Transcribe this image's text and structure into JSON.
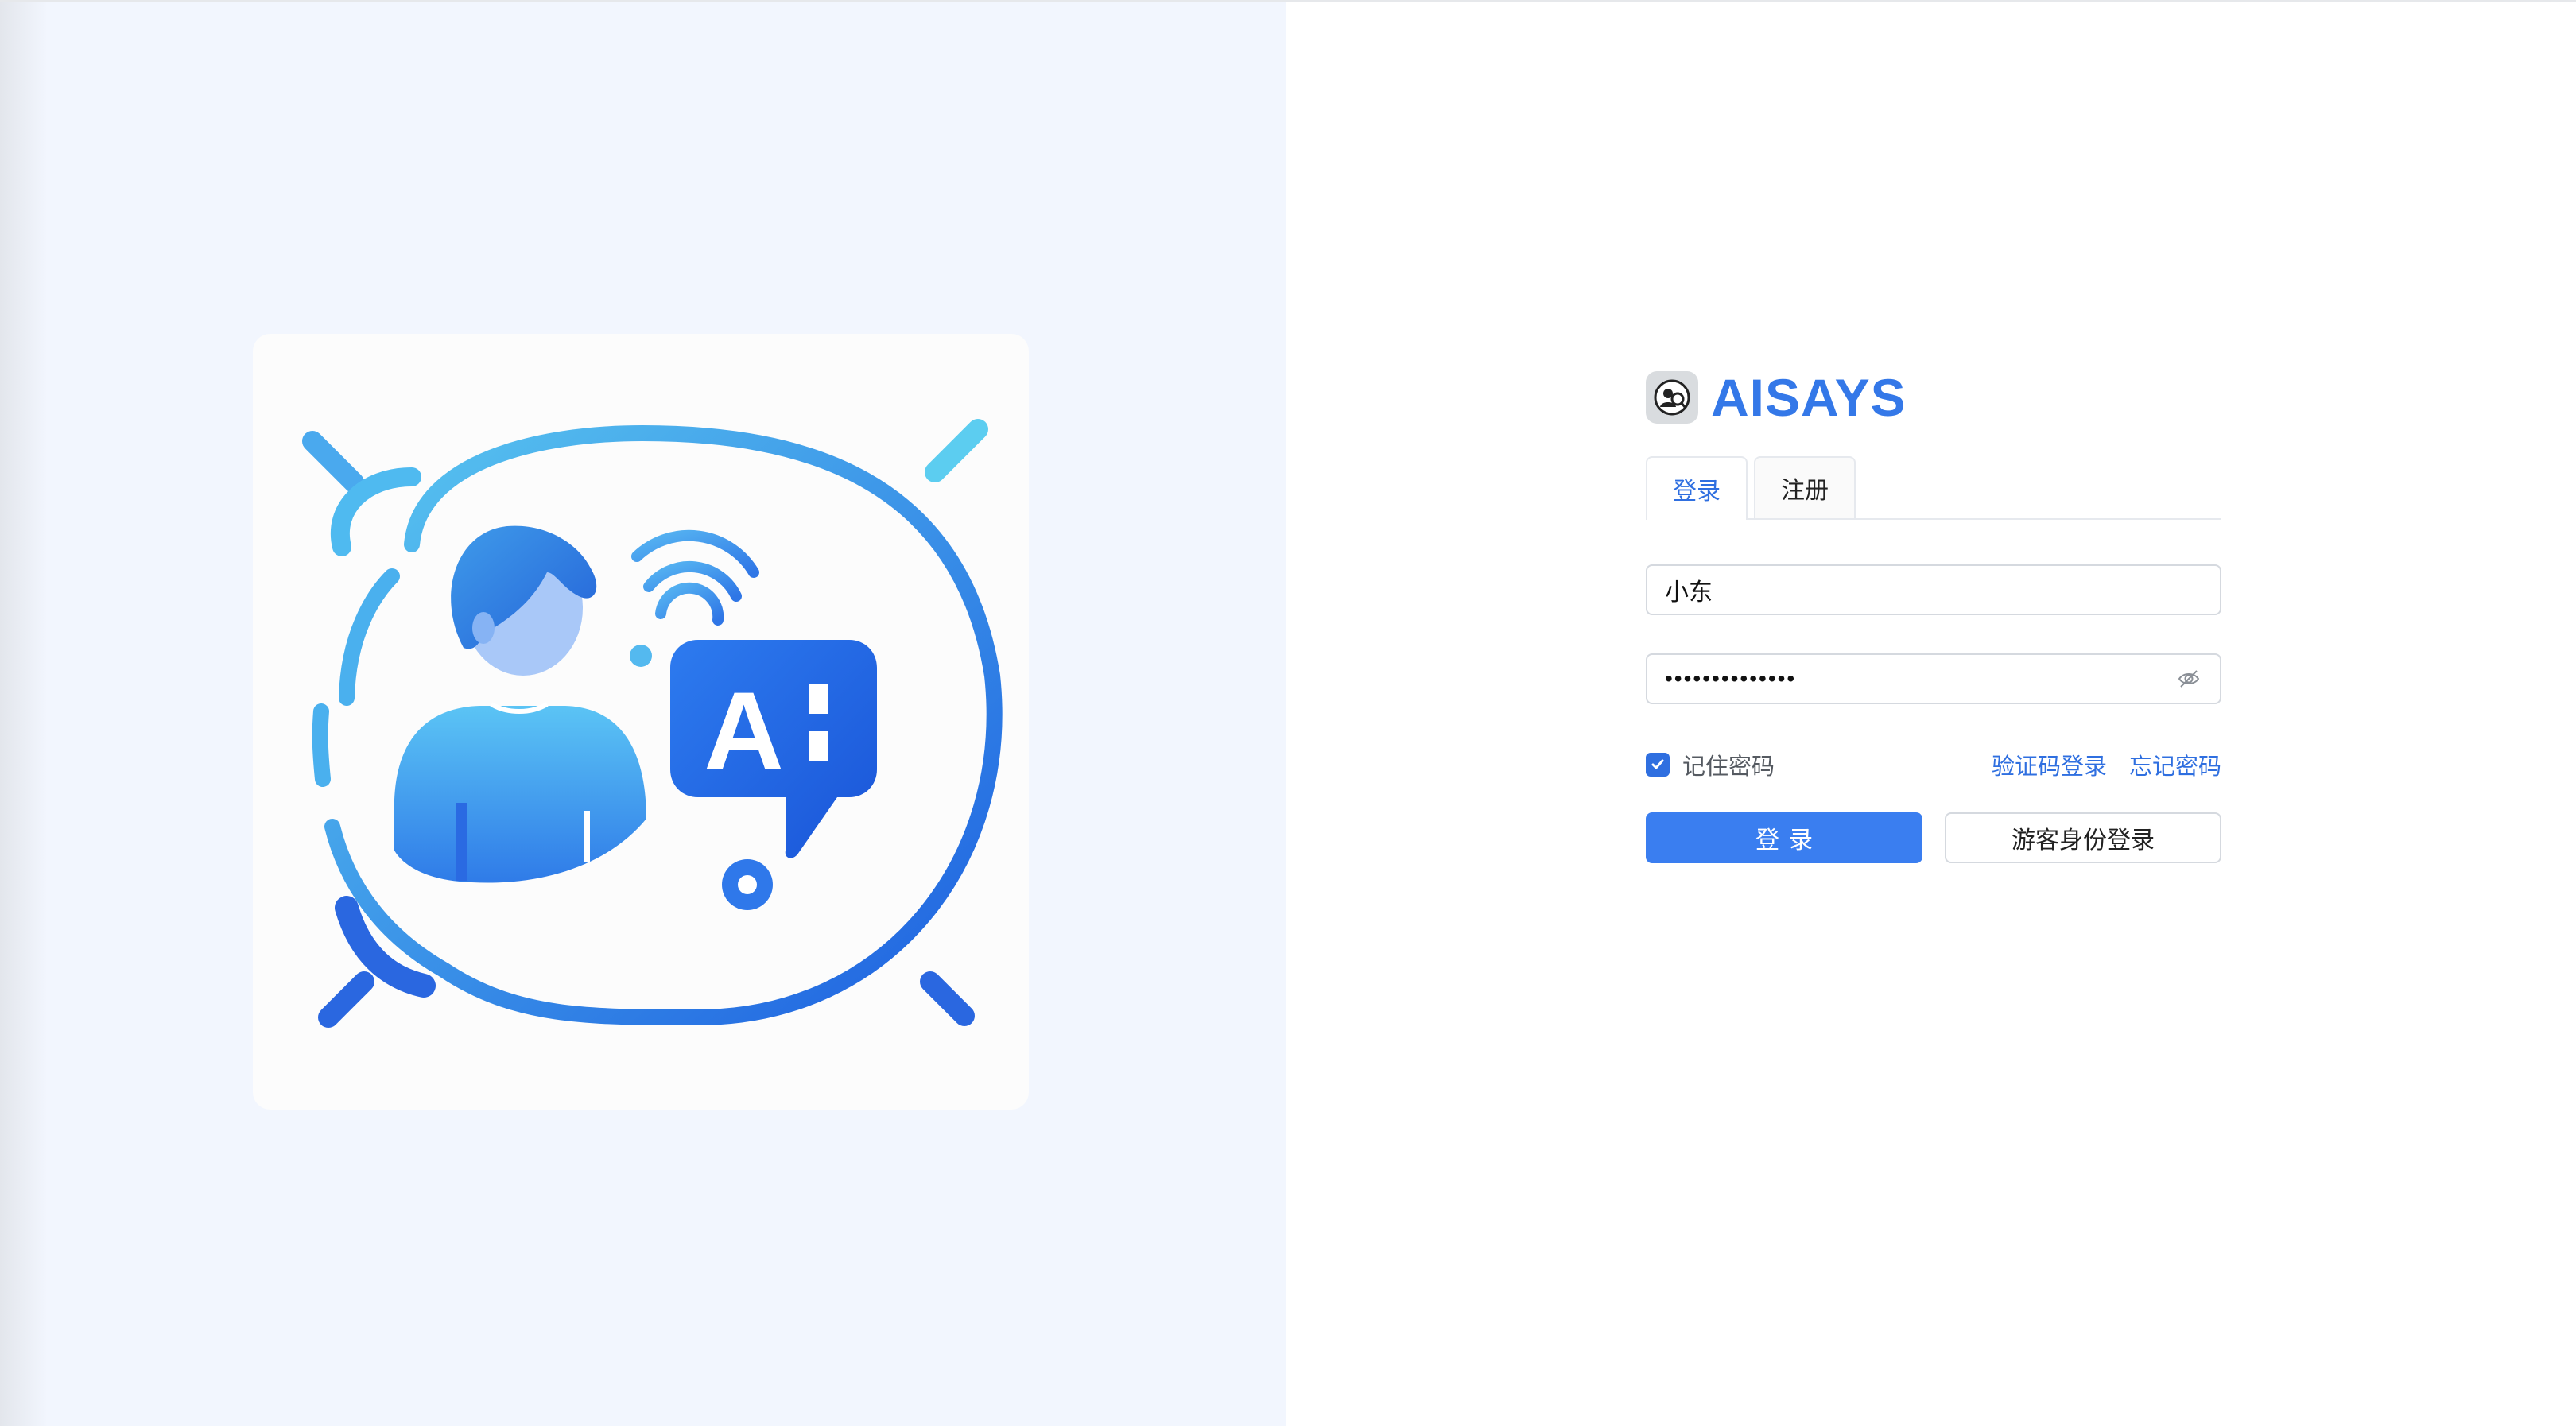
{
  "brand": {
    "name": "AISAYS",
    "accent_color": "#3478e8"
  },
  "illustration": {
    "badge_text": "A"
  },
  "tabs": [
    {
      "label": "登录",
      "active": true
    },
    {
      "label": "注册",
      "active": false
    }
  ],
  "form": {
    "username": {
      "value": "小东"
    },
    "password": {
      "masked_value": "••••••••••••••"
    },
    "remember": {
      "label": "记住密码",
      "checked": true
    },
    "sms_login_link": "验证码登录",
    "forgot_link": "忘记密码",
    "login_button": "登录",
    "guest_button": "游客身份登录"
  },
  "colors": {
    "primary": "#3a7ef0",
    "left_background": "#f2f6fe"
  },
  "icons": {
    "brand_logo": "aisays-logo-icon",
    "password_toggle": "eye-off-icon",
    "checkbox": "check-icon"
  }
}
